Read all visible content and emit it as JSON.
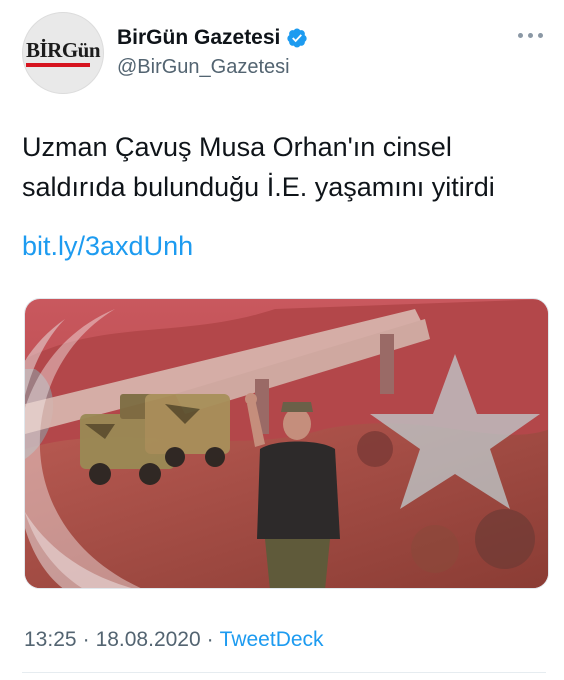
{
  "account": {
    "display_name": "BirGün Gazetesi",
    "handle": "@BirGun_Gazetesi",
    "avatar_text": "BİRGün",
    "verified": true
  },
  "tweet": {
    "text_line1": "Uzman Çavuş Musa Orhan'ın cinsel",
    "text_line2": "saldırıda bulunduğu İ.E. yaşamını yitirdi",
    "link": "bit.ly/3axdUnh"
  },
  "meta": {
    "time": "13:25",
    "separator1": "·",
    "date": "18.08.2020",
    "separator2": "·",
    "source": "TweetDeck"
  },
  "colors": {
    "link": "#1d9bf0",
    "verified": "#1d9bf0",
    "muted": "#536471",
    "brand_red": "#d6141f"
  },
  "icons": [
    "verified-badge-icon",
    "more-options-icon"
  ]
}
